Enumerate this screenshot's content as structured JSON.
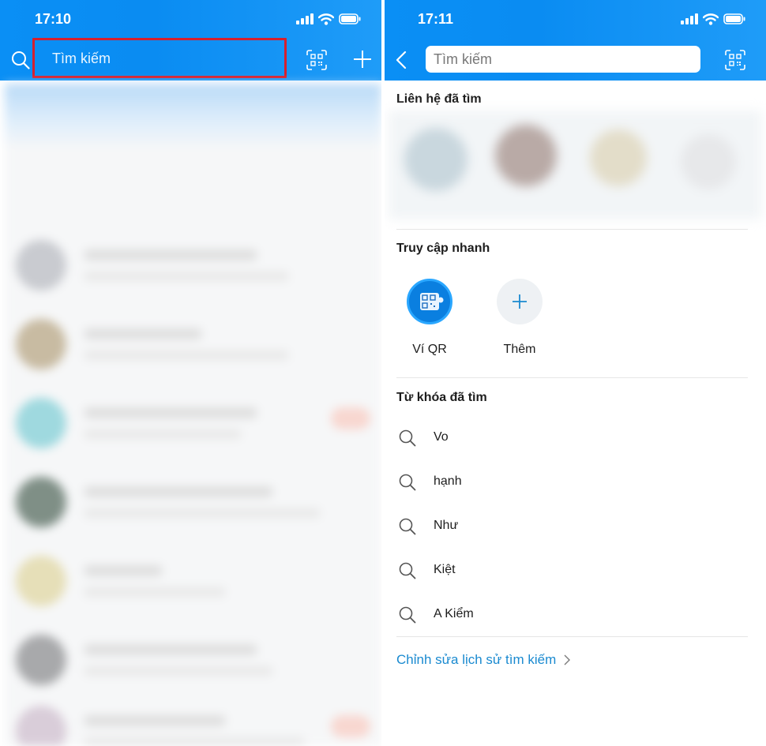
{
  "left": {
    "status_time": "17:10",
    "search_placeholder": "Tìm kiếm"
  },
  "right": {
    "status_time": "17:11",
    "search_placeholder": "Tìm kiếm",
    "recent_contacts_title": "Liên hệ đã tìm",
    "quick_access_title": "Truy cập nhanh",
    "quick_access": [
      {
        "label": "Ví QR",
        "icon": "qr-wallet-icon"
      },
      {
        "label": "Thêm",
        "icon": "plus-icon"
      }
    ],
    "keywords_title": "Từ khóa đã tìm",
    "keywords": [
      "Vo",
      "hạnh",
      "Như",
      "Kiệt",
      "A Kiểm"
    ],
    "edit_history_label": "Chỉnh sửa lịch sử tìm kiếm"
  },
  "colors": {
    "header_blue": "#0a8ff5",
    "highlight_red": "#d5202f",
    "link_blue": "#1a8ad0"
  }
}
